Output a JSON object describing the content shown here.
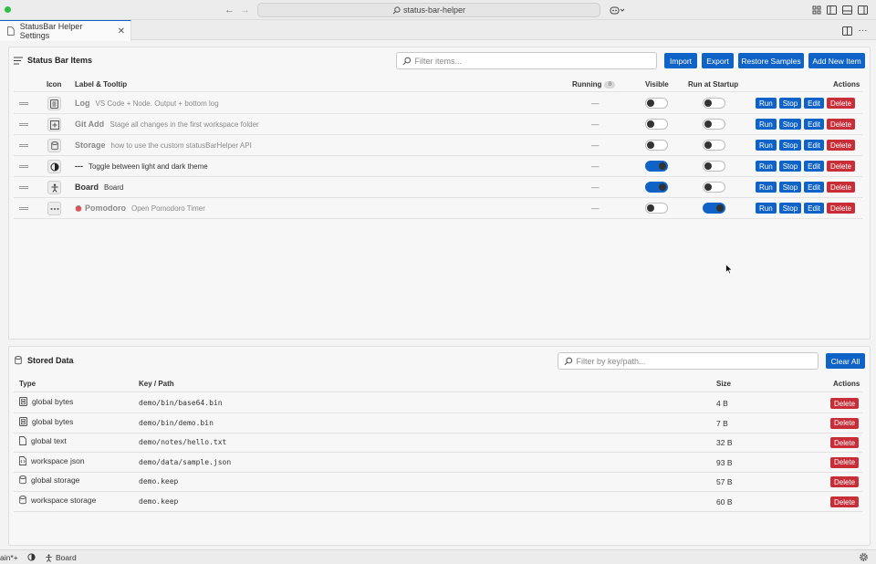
{
  "titlebar": {
    "search_text": "status-bar-helper"
  },
  "tab": {
    "title": "StatusBar Helper Settings"
  },
  "items_panel": {
    "title": "Status Bar Items",
    "filter_placeholder": "Filter items...",
    "buttons": {
      "import": "Import",
      "export": "Export",
      "restore": "Restore Samples",
      "add": "Add New Item"
    },
    "headers": {
      "icon": "Icon",
      "label": "Label & Tooltip",
      "running": "Running",
      "running_count": "0",
      "visible": "Visible",
      "startup": "Run at Startup",
      "actions": "Actions"
    },
    "action_labels": {
      "run": "Run",
      "stop": "Stop",
      "edit": "Edit",
      "delete": "Delete"
    },
    "rows": [
      {
        "icon": "log-icon",
        "label": "Log",
        "tooltip": "VS Code + Node. Output + bottom log",
        "running": "—",
        "visible": false,
        "startup": false,
        "dim": true
      },
      {
        "icon": "diff-added-icon",
        "label": "Git Add",
        "tooltip": "Stage all changes in the first workspace folder",
        "running": "—",
        "visible": false,
        "startup": false,
        "dim": true
      },
      {
        "icon": "database-icon",
        "label": "Storage",
        "tooltip": "how to use the custom statusBarHelper API",
        "running": "—",
        "visible": false,
        "startup": false,
        "dim": true
      },
      {
        "icon": "contrast-icon",
        "label": "---",
        "tooltip": "Toggle between light and dark theme",
        "running": "—",
        "visible": true,
        "startup": false,
        "dim": false
      },
      {
        "icon": "accessibility-icon",
        "label": "Board",
        "tooltip": "Board",
        "running": "—",
        "visible": true,
        "startup": false,
        "dim": false
      },
      {
        "icon": "ellipsis-icon",
        "label": "Pomodoro",
        "tooltip": "Open Pomodoro Timer",
        "running": "—",
        "visible": false,
        "startup": true,
        "dim": true,
        "emoji": "tomato-icon"
      }
    ]
  },
  "data_panel": {
    "title": "Stored Data",
    "filter_placeholder": "Filter by key/path...",
    "clear_all": "Clear All",
    "headers": {
      "type": "Type",
      "key": "Key / Path",
      "size": "Size",
      "actions": "Actions"
    },
    "delete_label": "Delete",
    "rows": [
      {
        "icon": "binary-file-icon",
        "type": "global bytes",
        "key": "demo/bin/base64.bin",
        "size": "4 B"
      },
      {
        "icon": "binary-file-icon",
        "type": "global bytes",
        "key": "demo/bin/demo.bin",
        "size": "7 B"
      },
      {
        "icon": "file-icon",
        "type": "global text",
        "key": "demo/notes/hello.txt",
        "size": "32 B"
      },
      {
        "icon": "json-file-icon",
        "type": "workspace json",
        "key": "demo/data/sample.json",
        "size": "93 B"
      },
      {
        "icon": "database-icon",
        "type": "global storage",
        "key": "demo.keep",
        "size": "57 B"
      },
      {
        "icon": "database-icon",
        "type": "workspace storage",
        "key": "demo.keep",
        "size": "60 B"
      }
    ]
  },
  "statusbar": {
    "branch": "ain*+",
    "board": "Board"
  },
  "colors": {
    "accent": "#0f62c6",
    "danger": "#c72e38"
  }
}
